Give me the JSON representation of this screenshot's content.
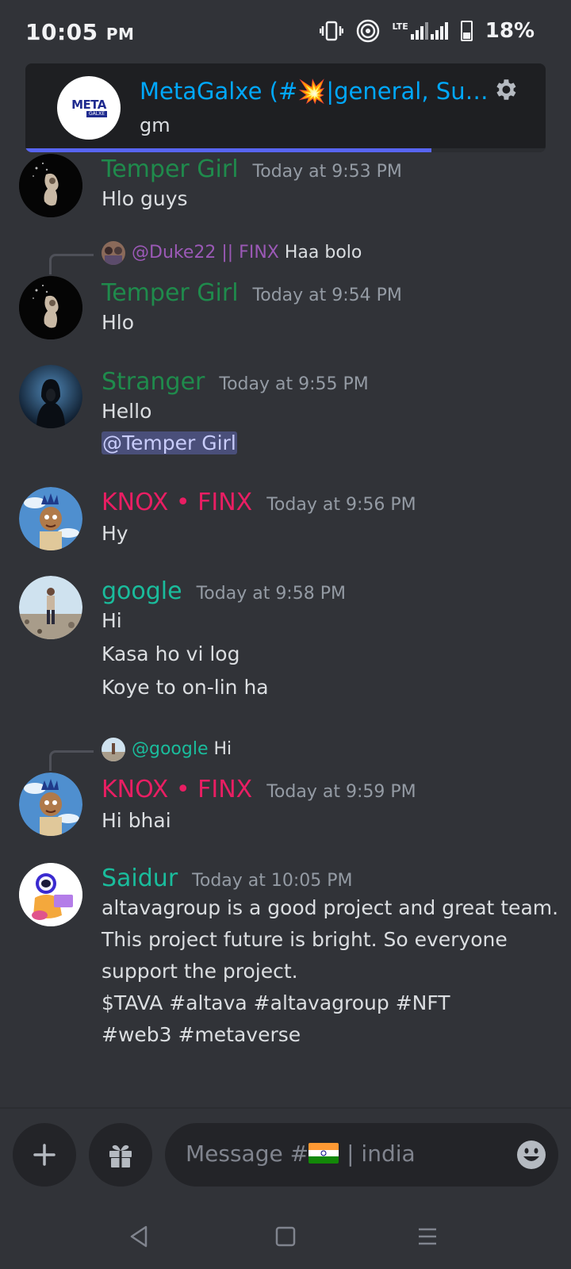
{
  "status_bar": {
    "time": "10:05",
    "ampm": "PM",
    "network": "LTE",
    "battery": "18%"
  },
  "banner": {
    "server_logo_text": "META",
    "server_logo_sub": "GALXE",
    "title": "MetaGalxe (#💥|general, Sui ...",
    "message": "gm",
    "settings_icon": "gear-icon",
    "progress": 0.78
  },
  "messages": [
    {
      "author": "Temper Girl",
      "author_color": "#1f8b4c",
      "timestamp": "Today at 9:53 PM",
      "lines": [
        "Hlo guys"
      ]
    },
    {
      "reply_to": {
        "author": "@Duke22 || FINX",
        "text": "Haa bolo",
        "color": "#9b59b6"
      },
      "author": "Temper Girl",
      "author_color": "#1f8b4c",
      "timestamp": "Today at 9:54 PM",
      "lines": [
        "Hlo"
      ]
    },
    {
      "author": "Stranger",
      "author_color": "#1f8b4c",
      "timestamp": "Today at 9:55 PM",
      "lines": [
        "Hello"
      ],
      "mention": "@Temper Girl"
    },
    {
      "author": "KNOX • FINX",
      "author_color": "#e91e63",
      "timestamp": "Today at 9:56 PM",
      "lines": [
        "Hy"
      ]
    },
    {
      "author": "google",
      "author_color": "#1abc9c",
      "timestamp": "Today at 9:58 PM",
      "lines": [
        "Hi",
        "Kasa ho vi log",
        "Koye to on-lin ha"
      ]
    },
    {
      "reply_to": {
        "author": "@google",
        "text": "Hi",
        "color": "#1abc9c"
      },
      "author": "KNOX • FINX",
      "author_color": "#e91e63",
      "timestamp": "Today at 9:59 PM",
      "lines": [
        "Hi bhai"
      ]
    },
    {
      "author": "Saidur",
      "author_color": "#1abc9c",
      "timestamp": "Today at 10:05 PM",
      "lines": [
        "altavagroup is a good project and great team.",
        "This project future is bright. So everyone",
        "support the project.",
        "$TAVA #altava #altavagroup #NFT",
        "#web3 #metaverse"
      ]
    }
  ],
  "composer": {
    "add_icon": "plus-icon",
    "gift_icon": "gift-icon",
    "placeholder_prefix": "Message #",
    "placeholder_channel": "| india",
    "emoji_icon": "smiley-icon"
  },
  "navigation": {
    "back_icon": "back-triangle-icon",
    "home_icon": "home-square-icon",
    "menu_icon": "menu-lines-icon"
  }
}
